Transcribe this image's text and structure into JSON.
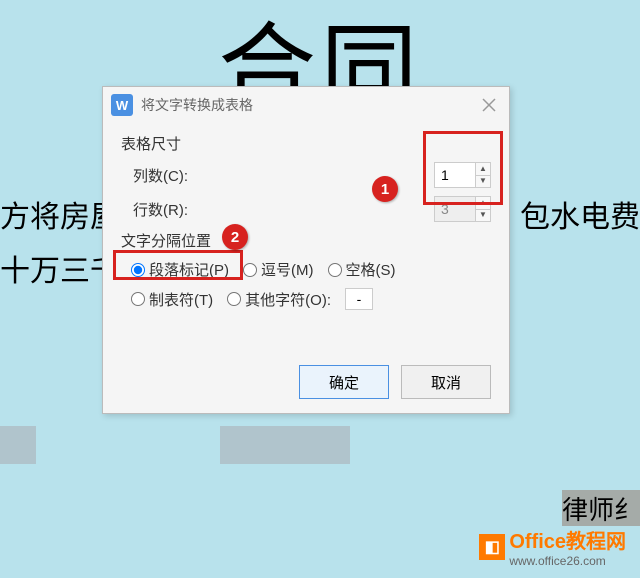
{
  "background": {
    "title": "合同",
    "line1_left": "方将房屋出",
    "line1_right": "包水电费",
    "line2_left": "十万三千力",
    "bottom_box": "律师纟"
  },
  "dialog": {
    "title": "将文字转换成表格",
    "section_size": "表格尺寸",
    "cols_label": "列数(C):",
    "cols_value": "1",
    "rows_label": "行数(R):",
    "rows_value": "3",
    "section_sep": "文字分隔位置",
    "radios": {
      "paragraph": "段落标记(P)",
      "comma": "逗号(M)",
      "space": "空格(S)",
      "tab": "制表符(T)",
      "other": "其他字符(O):",
      "other_char": "-"
    },
    "ok": "确定",
    "cancel": "取消"
  },
  "markers": {
    "m1": "1",
    "m2": "2"
  },
  "watermark": {
    "brand": "Office教程网",
    "url": "www.office26.com"
  }
}
